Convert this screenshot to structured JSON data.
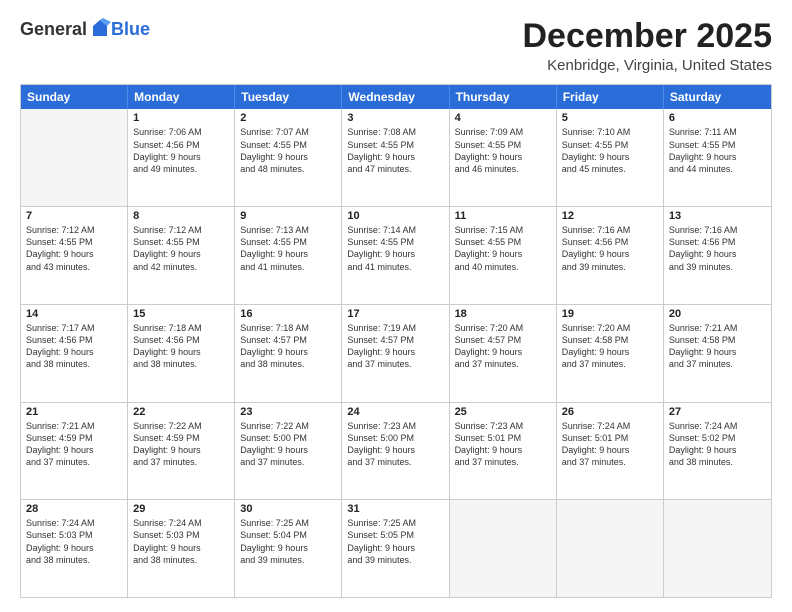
{
  "logo": {
    "general": "General",
    "blue": "Blue"
  },
  "header": {
    "title": "December 2025",
    "subtitle": "Kenbridge, Virginia, United States"
  },
  "days_of_week": [
    "Sunday",
    "Monday",
    "Tuesday",
    "Wednesday",
    "Thursday",
    "Friday",
    "Saturday"
  ],
  "weeks": [
    [
      {
        "day": "",
        "lines": [],
        "empty": true
      },
      {
        "day": "1",
        "lines": [
          "Sunrise: 7:06 AM",
          "Sunset: 4:56 PM",
          "Daylight: 9 hours",
          "and 49 minutes."
        ]
      },
      {
        "day": "2",
        "lines": [
          "Sunrise: 7:07 AM",
          "Sunset: 4:55 PM",
          "Daylight: 9 hours",
          "and 48 minutes."
        ]
      },
      {
        "day": "3",
        "lines": [
          "Sunrise: 7:08 AM",
          "Sunset: 4:55 PM",
          "Daylight: 9 hours",
          "and 47 minutes."
        ]
      },
      {
        "day": "4",
        "lines": [
          "Sunrise: 7:09 AM",
          "Sunset: 4:55 PM",
          "Daylight: 9 hours",
          "and 46 minutes."
        ]
      },
      {
        "day": "5",
        "lines": [
          "Sunrise: 7:10 AM",
          "Sunset: 4:55 PM",
          "Daylight: 9 hours",
          "and 45 minutes."
        ]
      },
      {
        "day": "6",
        "lines": [
          "Sunrise: 7:11 AM",
          "Sunset: 4:55 PM",
          "Daylight: 9 hours",
          "and 44 minutes."
        ]
      }
    ],
    [
      {
        "day": "7",
        "lines": [
          "Sunrise: 7:12 AM",
          "Sunset: 4:55 PM",
          "Daylight: 9 hours",
          "and 43 minutes."
        ]
      },
      {
        "day": "8",
        "lines": [
          "Sunrise: 7:12 AM",
          "Sunset: 4:55 PM",
          "Daylight: 9 hours",
          "and 42 minutes."
        ]
      },
      {
        "day": "9",
        "lines": [
          "Sunrise: 7:13 AM",
          "Sunset: 4:55 PM",
          "Daylight: 9 hours",
          "and 41 minutes."
        ]
      },
      {
        "day": "10",
        "lines": [
          "Sunrise: 7:14 AM",
          "Sunset: 4:55 PM",
          "Daylight: 9 hours",
          "and 41 minutes."
        ]
      },
      {
        "day": "11",
        "lines": [
          "Sunrise: 7:15 AM",
          "Sunset: 4:55 PM",
          "Daylight: 9 hours",
          "and 40 minutes."
        ]
      },
      {
        "day": "12",
        "lines": [
          "Sunrise: 7:16 AM",
          "Sunset: 4:56 PM",
          "Daylight: 9 hours",
          "and 39 minutes."
        ]
      },
      {
        "day": "13",
        "lines": [
          "Sunrise: 7:16 AM",
          "Sunset: 4:56 PM",
          "Daylight: 9 hours",
          "and 39 minutes."
        ]
      }
    ],
    [
      {
        "day": "14",
        "lines": [
          "Sunrise: 7:17 AM",
          "Sunset: 4:56 PM",
          "Daylight: 9 hours",
          "and 38 minutes."
        ]
      },
      {
        "day": "15",
        "lines": [
          "Sunrise: 7:18 AM",
          "Sunset: 4:56 PM",
          "Daylight: 9 hours",
          "and 38 minutes."
        ]
      },
      {
        "day": "16",
        "lines": [
          "Sunrise: 7:18 AM",
          "Sunset: 4:57 PM",
          "Daylight: 9 hours",
          "and 38 minutes."
        ]
      },
      {
        "day": "17",
        "lines": [
          "Sunrise: 7:19 AM",
          "Sunset: 4:57 PM",
          "Daylight: 9 hours",
          "and 37 minutes."
        ]
      },
      {
        "day": "18",
        "lines": [
          "Sunrise: 7:20 AM",
          "Sunset: 4:57 PM",
          "Daylight: 9 hours",
          "and 37 minutes."
        ]
      },
      {
        "day": "19",
        "lines": [
          "Sunrise: 7:20 AM",
          "Sunset: 4:58 PM",
          "Daylight: 9 hours",
          "and 37 minutes."
        ]
      },
      {
        "day": "20",
        "lines": [
          "Sunrise: 7:21 AM",
          "Sunset: 4:58 PM",
          "Daylight: 9 hours",
          "and 37 minutes."
        ]
      }
    ],
    [
      {
        "day": "21",
        "lines": [
          "Sunrise: 7:21 AM",
          "Sunset: 4:59 PM",
          "Daylight: 9 hours",
          "and 37 minutes."
        ]
      },
      {
        "day": "22",
        "lines": [
          "Sunrise: 7:22 AM",
          "Sunset: 4:59 PM",
          "Daylight: 9 hours",
          "and 37 minutes."
        ]
      },
      {
        "day": "23",
        "lines": [
          "Sunrise: 7:22 AM",
          "Sunset: 5:00 PM",
          "Daylight: 9 hours",
          "and 37 minutes."
        ]
      },
      {
        "day": "24",
        "lines": [
          "Sunrise: 7:23 AM",
          "Sunset: 5:00 PM",
          "Daylight: 9 hours",
          "and 37 minutes."
        ]
      },
      {
        "day": "25",
        "lines": [
          "Sunrise: 7:23 AM",
          "Sunset: 5:01 PM",
          "Daylight: 9 hours",
          "and 37 minutes."
        ]
      },
      {
        "day": "26",
        "lines": [
          "Sunrise: 7:24 AM",
          "Sunset: 5:01 PM",
          "Daylight: 9 hours",
          "and 37 minutes."
        ]
      },
      {
        "day": "27",
        "lines": [
          "Sunrise: 7:24 AM",
          "Sunset: 5:02 PM",
          "Daylight: 9 hours",
          "and 38 minutes."
        ]
      }
    ],
    [
      {
        "day": "28",
        "lines": [
          "Sunrise: 7:24 AM",
          "Sunset: 5:03 PM",
          "Daylight: 9 hours",
          "and 38 minutes."
        ]
      },
      {
        "day": "29",
        "lines": [
          "Sunrise: 7:24 AM",
          "Sunset: 5:03 PM",
          "Daylight: 9 hours",
          "and 38 minutes."
        ]
      },
      {
        "day": "30",
        "lines": [
          "Sunrise: 7:25 AM",
          "Sunset: 5:04 PM",
          "Daylight: 9 hours",
          "and 39 minutes."
        ]
      },
      {
        "day": "31",
        "lines": [
          "Sunrise: 7:25 AM",
          "Sunset: 5:05 PM",
          "Daylight: 9 hours",
          "and 39 minutes."
        ]
      },
      {
        "day": "",
        "lines": [],
        "empty": true
      },
      {
        "day": "",
        "lines": [],
        "empty": true
      },
      {
        "day": "",
        "lines": [],
        "empty": true
      }
    ]
  ]
}
